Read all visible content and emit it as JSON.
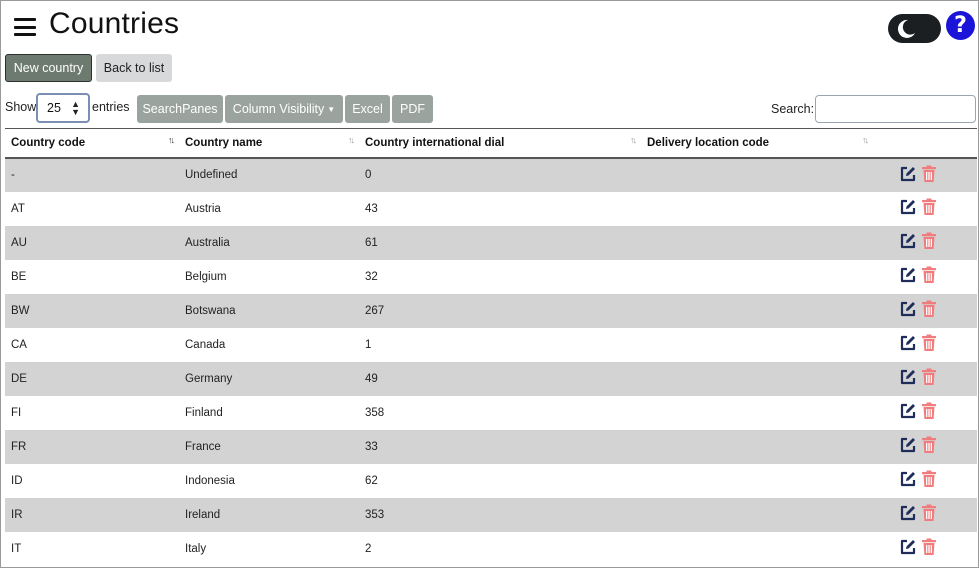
{
  "header": {
    "title": "Countries",
    "menu_icon": "hamburger-menu-icon",
    "theme_icon": "moon-icon",
    "help_label": "?"
  },
  "toolbar": {
    "new_label": "New country",
    "back_label": "Back to list"
  },
  "controls": {
    "show_label": "Show",
    "length_value": "25",
    "entries_label": "entries",
    "buttons": [
      "SearchPanes",
      "Column Visibility",
      "Excel",
      "PDF"
    ],
    "search_label": "Search:",
    "search_value": ""
  },
  "table": {
    "columns": [
      "Country code",
      "Country name",
      "Country international dial",
      "Delivery location code"
    ],
    "rows": [
      [
        "-",
        "Undefined",
        "0",
        ""
      ],
      [
        "AT",
        "Austria",
        "43",
        ""
      ],
      [
        "AU",
        "Australia",
        "61",
        ""
      ],
      [
        "BE",
        "Belgium",
        "32",
        ""
      ],
      [
        "BW",
        "Botswana",
        "267",
        ""
      ],
      [
        "CA",
        "Canada",
        "1",
        ""
      ],
      [
        "DE",
        "Germany",
        "49",
        ""
      ],
      [
        "FI",
        "Finland",
        "358",
        ""
      ],
      [
        "FR",
        "France",
        "33",
        ""
      ],
      [
        "ID",
        "Indonesia",
        "62",
        ""
      ],
      [
        "IR",
        "Ireland",
        "353",
        ""
      ],
      [
        "IT",
        "Italy",
        "2",
        ""
      ]
    ],
    "edit_icon": "edit-icon",
    "delete_icon": "trash-icon"
  },
  "colors": {
    "primary_button": "#6d7a6f",
    "secondary_button": "#d7d9da",
    "gray_button": "#9ba39e",
    "stripe": "#d3d3d3",
    "edit_icon": "#1f2d5a",
    "delete_icon": "#f07d7d",
    "help_icon": "#1a14d8",
    "toggle": "#1b1f22"
  }
}
